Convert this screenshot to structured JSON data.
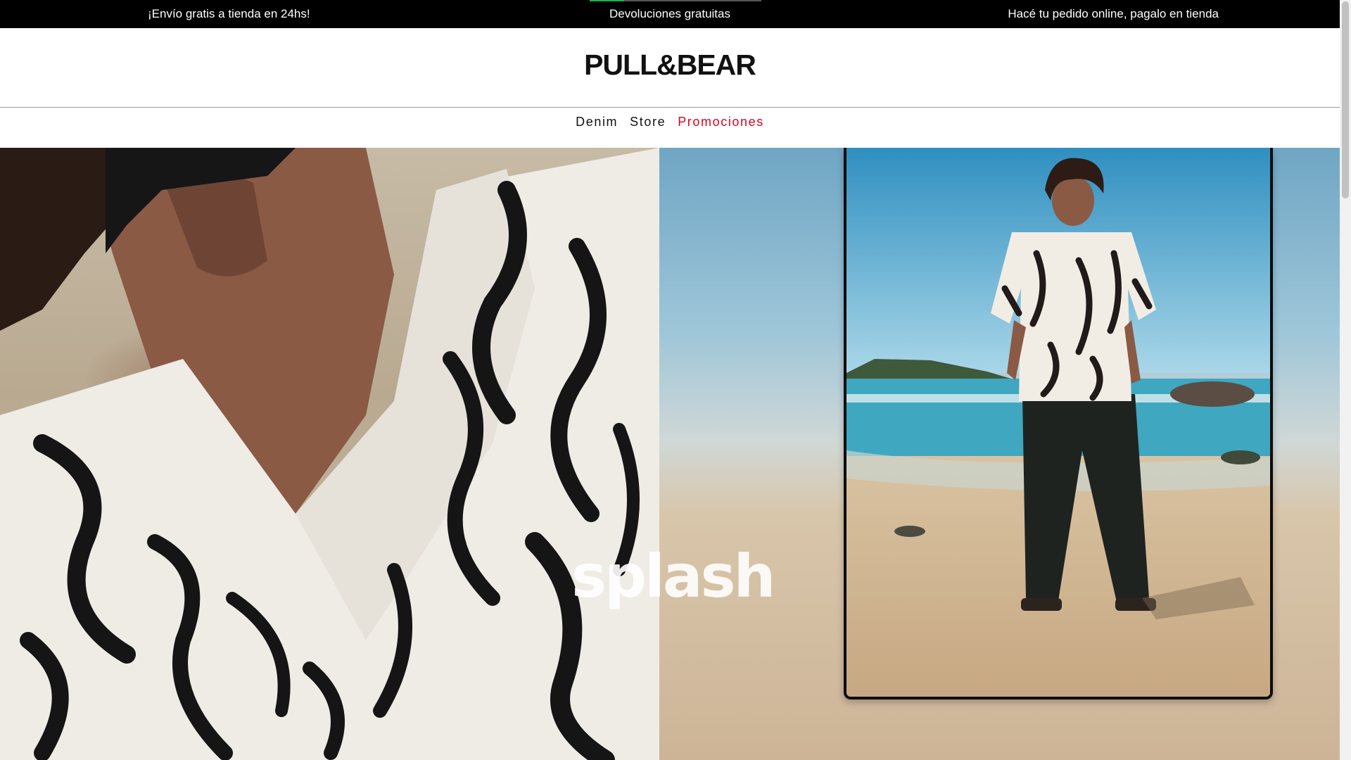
{
  "announcement_bar": {
    "messages": [
      "¡Envío gratis a tienda en 24hs!",
      "Devoluciones gratuitas",
      "Hacé tu pedido online, pagalo en tienda"
    ],
    "active_progress": 0.2
  },
  "header": {
    "logo": "PULL&BEAR"
  },
  "nav": {
    "items": [
      {
        "label": "Denim"
      },
      {
        "label": "Store"
      },
      {
        "label": "Promociones"
      }
    ],
    "promo_color": "#e2001a"
  },
  "hero": {
    "headline": "splash"
  }
}
